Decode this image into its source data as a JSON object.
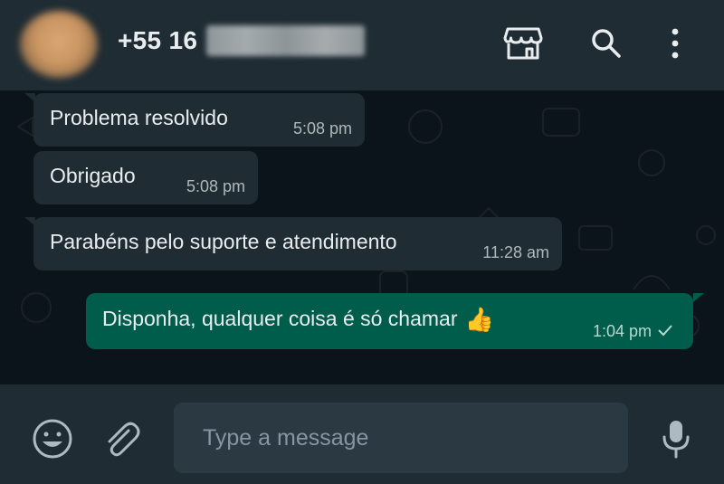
{
  "header": {
    "contact_name": "+55 16",
    "icons": [
      "store-icon",
      "search-icon",
      "menu-icon"
    ]
  },
  "messages": [
    {
      "direction": "incoming",
      "text": "Problema resolvido",
      "time": "5:08 pm"
    },
    {
      "direction": "incoming",
      "text": "Obrigado",
      "time": "5:08 pm"
    },
    {
      "direction": "incoming",
      "text": "Parabéns pelo suporte e atendimento",
      "time": "11:28 am"
    },
    {
      "direction": "outgoing",
      "text": "Disponha, qualquer coisa é só chamar",
      "emoji": "👍",
      "time": "1:04 pm",
      "status": "sent"
    }
  ],
  "composer": {
    "placeholder": "Type a message",
    "icons": [
      "emoji-icon",
      "attach-icon",
      "mic-icon"
    ]
  },
  "colors": {
    "header_bg": "#1f2c34",
    "chat_bg": "#0b141a",
    "incoming_bubble": "#202c33",
    "outgoing_bubble": "#005c4b",
    "input_bg": "#2a3942",
    "icon": "#aebac1"
  }
}
